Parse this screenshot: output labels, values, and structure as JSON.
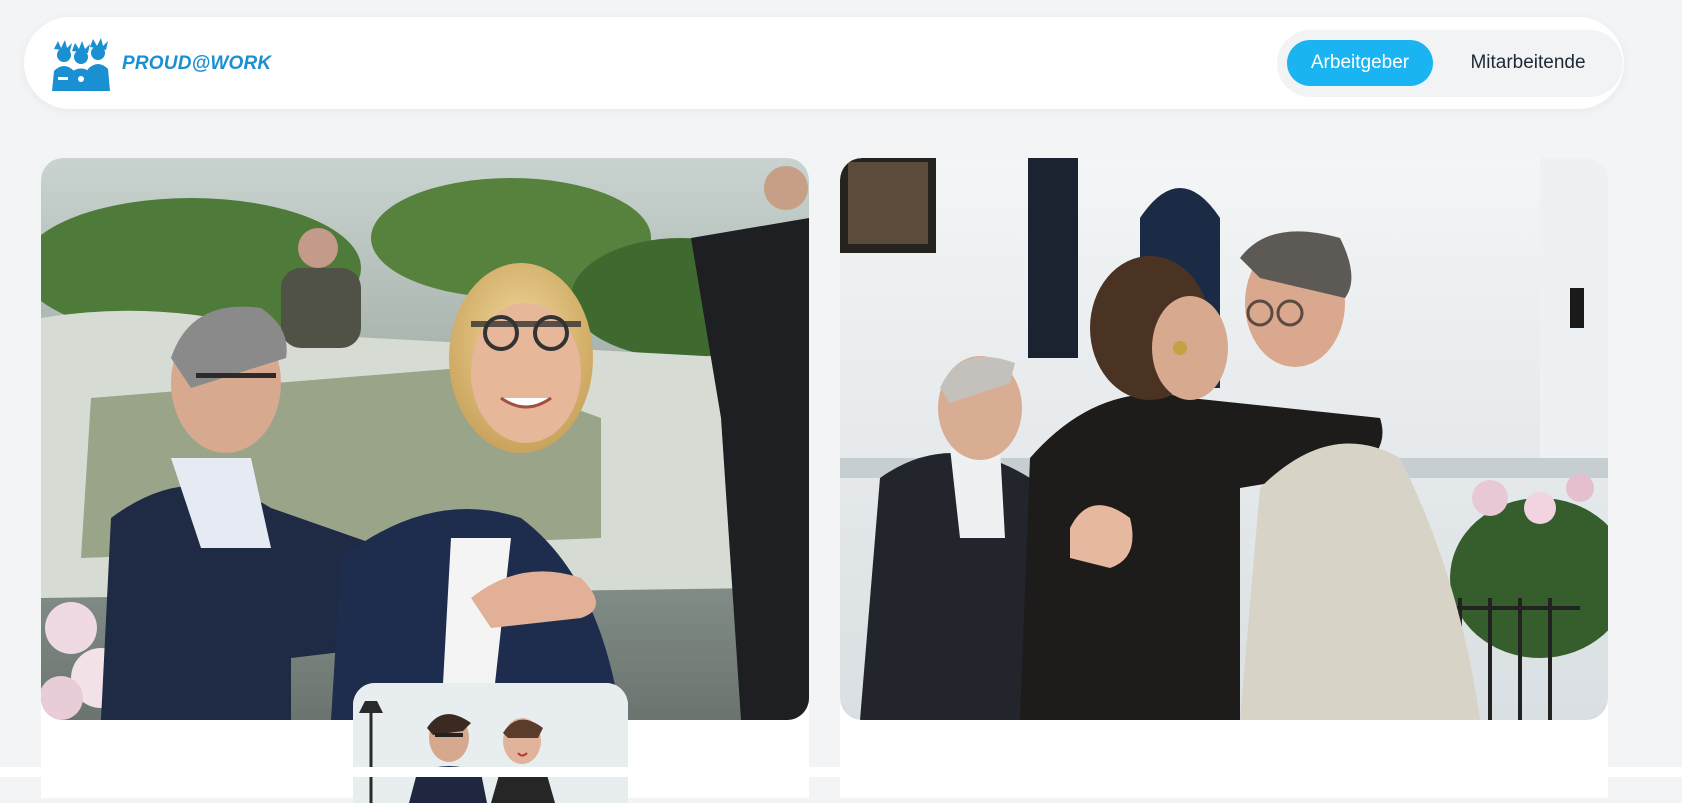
{
  "brand": {
    "name": "PROUD@WORK",
    "color": "#1a8fd1",
    "logo_icon": "people-group-icon"
  },
  "nav": {
    "toggle": {
      "employer_label": "Arbeitgeber",
      "employees_label": "Mitarbeitende",
      "active": "employer",
      "active_color": "#1bb4f2"
    }
  },
  "cards": [
    {
      "image": "photo-man-and-woman-smiling-conversation"
    },
    {
      "image": "photo-two-people-hugging"
    }
  ],
  "thumbnail": {
    "image": "photo-two-people-portrait"
  }
}
